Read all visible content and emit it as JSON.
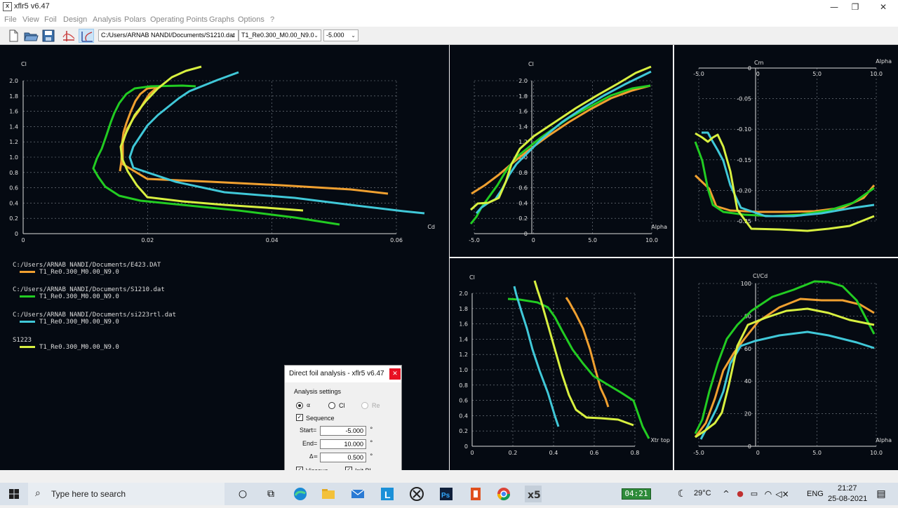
{
  "window": {
    "title": "xflr5 v6.47",
    "app_icon": "xflr5-icon",
    "minimize_glyph": "—",
    "maximize_glyph": "❐",
    "close_glyph": "✕"
  },
  "menu": [
    "File",
    "View",
    "Foil",
    "Design",
    "Analysis",
    "Polars",
    "Operating Points",
    "Graphs",
    "Options",
    "?"
  ],
  "toolbar": {
    "foil_path": "C:/Users/ARNAB NANDI/Documents/S1210.dat",
    "polar_name": "T1_Re0.300_M0.00_N9.0",
    "opp_value": "-5.000",
    "icons": [
      "new-file-icon",
      "open-folder-icon",
      "save-icon",
      "opp-view-icon",
      "polar-view-icon"
    ]
  },
  "colors": {
    "orange": "#f0a030",
    "green": "#22cc22",
    "cyan": "#40c8d8",
    "yellow": "#d8f040",
    "grid": "#808890",
    "panel_bg": "#050a12"
  },
  "graphs": {
    "cl_cd": {
      "xlabel": "Cd",
      "ylabel": "Cl",
      "xticks": [
        "0",
        "0.02",
        "0.04",
        "0.06"
      ],
      "yticks": [
        "0",
        "0.2",
        "0.4",
        "0.6",
        "0.8",
        "1.0",
        "1.2",
        "1.4",
        "1.6",
        "1.8",
        "2.0"
      ]
    },
    "cl_alpha": {
      "xlabel": "Alpha",
      "ylabel": "Cl",
      "xticks": [
        "-5.0",
        "0",
        "5.0",
        "10.0"
      ],
      "yticks": [
        "0",
        "0.2",
        "0.4",
        "0.6",
        "0.8",
        "1.0",
        "1.2",
        "1.4",
        "1.6",
        "1.8",
        "2.0"
      ]
    },
    "cm_alpha": {
      "xlabel": "Alpha",
      "ylabel": "Cm",
      "xticks": [
        "-5.0",
        "0",
        "5.0",
        "10.0"
      ],
      "yticks": [
        "0",
        "-0.05",
        "-0.10",
        "-0.15",
        "-0.20",
        "-0.25"
      ]
    },
    "cl_xtr": {
      "xlabel": "Xtr top",
      "ylabel": "Cl",
      "xticks": [
        "0",
        "0.2",
        "0.4",
        "0.6",
        "0.8"
      ],
      "yticks": [
        "0",
        "0.2",
        "0.4",
        "0.6",
        "0.8",
        "1.0",
        "1.2",
        "1.4",
        "1.6",
        "1.8",
        "2.0"
      ]
    },
    "clcd_alpha": {
      "xlabel": "Alpha",
      "ylabel": "Cl/Cd",
      "xticks": [
        "-5.0",
        "0",
        "5.0",
        "10.0"
      ],
      "yticks": [
        "0",
        "20",
        "40",
        "60",
        "80",
        "100"
      ]
    }
  },
  "legend": [
    {
      "file": "C:/Users/ARNAB NANDI/Documents/E423.DAT",
      "polar": "T1_Re0.300_M0.00_N9.0",
      "color": "#f0a030"
    },
    {
      "file": "C:/Users/ARNAB NANDI/Documents/S1210.dat",
      "polar": "T1_Re0.300_M0.00_N9.0",
      "color": "#22cc22"
    },
    {
      "file": "C:/Users/ARNAB NANDI/Documents/si223rtl.dat",
      "polar": "T1_Re0.300_M0.00_N9.0",
      "color": "#40c8d8"
    },
    {
      "file": "S1223",
      "polar": "T1_Re0.300_M0.00_N9.0",
      "color": "#d8f040"
    }
  ],
  "dialog": {
    "title": "Direct foil analysis - xflr5 v6.47",
    "close_glyph": "✕",
    "section": "Analysis settings",
    "radio_alpha": "α",
    "radio_cl": "Cl",
    "radio_re": "Re",
    "sequence_label": "Sequence",
    "start_label": "Start=",
    "start_value": "-5.000",
    "end_label": "End=",
    "end_value": "10.000",
    "delta_label": "Δ=",
    "delta_value": "0.500",
    "unit": "°",
    "viscous_label": "Viscous",
    "initbl_label": "Init BL"
  },
  "taskbar": {
    "search_placeholder": "Type here to search",
    "timer": "04:21",
    "weather": "29°C",
    "lang": "ENG",
    "time": "21:27",
    "date": "25-08-2021"
  }
}
